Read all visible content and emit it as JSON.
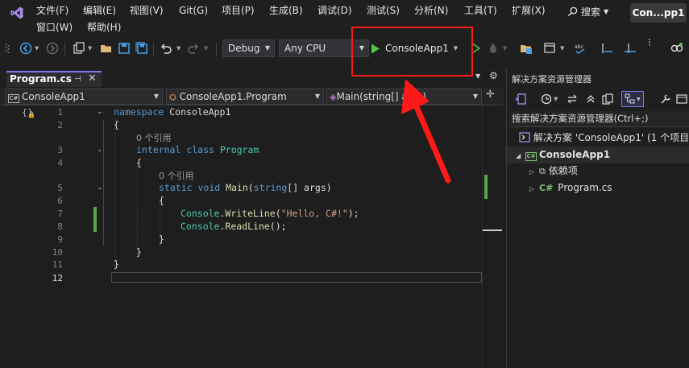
{
  "menu": {
    "items": [
      "文件(F)",
      "编辑(E)",
      "视图(V)",
      "Git(G)",
      "项目(P)",
      "生成(B)",
      "调试(D)",
      "测试(S)",
      "分析(N)",
      "工具(T)",
      "扩展(X)",
      "窗口(W)",
      "帮助(H)"
    ],
    "search_label": "搜索",
    "solution_badge": "Con...pp1"
  },
  "toolbar": {
    "configuration": "Debug",
    "platform": "Any CPU",
    "run_target": "ConsoleApp1"
  },
  "editor": {
    "tab_title": "Program.cs",
    "nav": {
      "project": "ConsoleApp1",
      "class": "ConsoleApp1.Program",
      "member": "Main(string[] args)"
    },
    "line_numbers": [
      "1",
      "2",
      "3",
      "4",
      "5",
      "6",
      "7",
      "8",
      "9",
      "10",
      "11",
      "12"
    ],
    "code": {
      "l1_kw": "namespace",
      "l1_name": " ConsoleApp1",
      "l2": "{",
      "ref1": "0 个引用",
      "l3_kw1": "internal",
      "l3_kw2": " class",
      "l3_type": " Program",
      "l4": "{",
      "ref2": "0 个引用",
      "l5_kw1": "static",
      "l5_kw2": " void",
      "l5_fn": " Main",
      "l5_p1": "(",
      "l5_kw3": "string",
      "l5_rest": "[] args)",
      "l6": "{",
      "l7_type": "Console",
      "l7_dot": ".",
      "l7_fn": "WriteLine",
      "l7_open": "(",
      "l7_str": "\"Hello, C#!\"",
      "l7_close": ");",
      "l8_type": "Console",
      "l8_dot": ".",
      "l8_fn": "ReadLine",
      "l8_rest": "();",
      "l9": "}",
      "l10": "}",
      "l11": "}"
    }
  },
  "solution_explorer": {
    "title": "解决方案资源管理器",
    "search_placeholder": "搜索解决方案资源管理器(Ctrl+;)",
    "solution": "解决方案 'ConsoleApp1' (1 个项目",
    "project": "ConsoleApp1",
    "dependencies": "依赖项",
    "file": "Program.cs"
  },
  "colors": {
    "accent": "#7a7af0",
    "run_green": "#4ec94e",
    "annotation_red": "#ff1a1a",
    "change_green": "#57a64a"
  }
}
